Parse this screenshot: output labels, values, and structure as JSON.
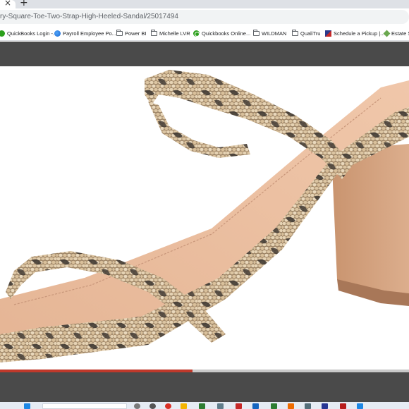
{
  "browser": {
    "tab_close_glyph": "×",
    "new_tab_glyph": "+",
    "url": "ry-Square-Toe-Two-Strap-High-Heeled-Sandal/25017494",
    "bookmarks": [
      {
        "label": "QuickBooks Login -...",
        "icon": "quickbooks-icon"
      },
      {
        "label": "Payroll Employee Po...",
        "icon": "globe-icon"
      },
      {
        "label": "Power BI",
        "icon": "folder-icon"
      },
      {
        "label": "Michelle LVR",
        "icon": "folder-icon"
      },
      {
        "label": "Quickbooks Online...",
        "icon": "quickbooks-icon"
      },
      {
        "label": "WILDMAN",
        "icon": "folder-icon"
      },
      {
        "label": "QualiTru",
        "icon": "folder-icon"
      },
      {
        "label": "Schedule a Pickup |...",
        "icon": "schedule-icon"
      },
      {
        "label": "Estate S",
        "icon": "tag-icon"
      }
    ]
  },
  "viewer": {
    "image_subject": "snakeskin two-strap block-heel sandal",
    "video_progress": 0.47
  },
  "colors": {
    "dark_bar": "#4a4a4a",
    "progress": "#c0392b",
    "insole": "#e8b898",
    "heel": "#d3a383"
  }
}
